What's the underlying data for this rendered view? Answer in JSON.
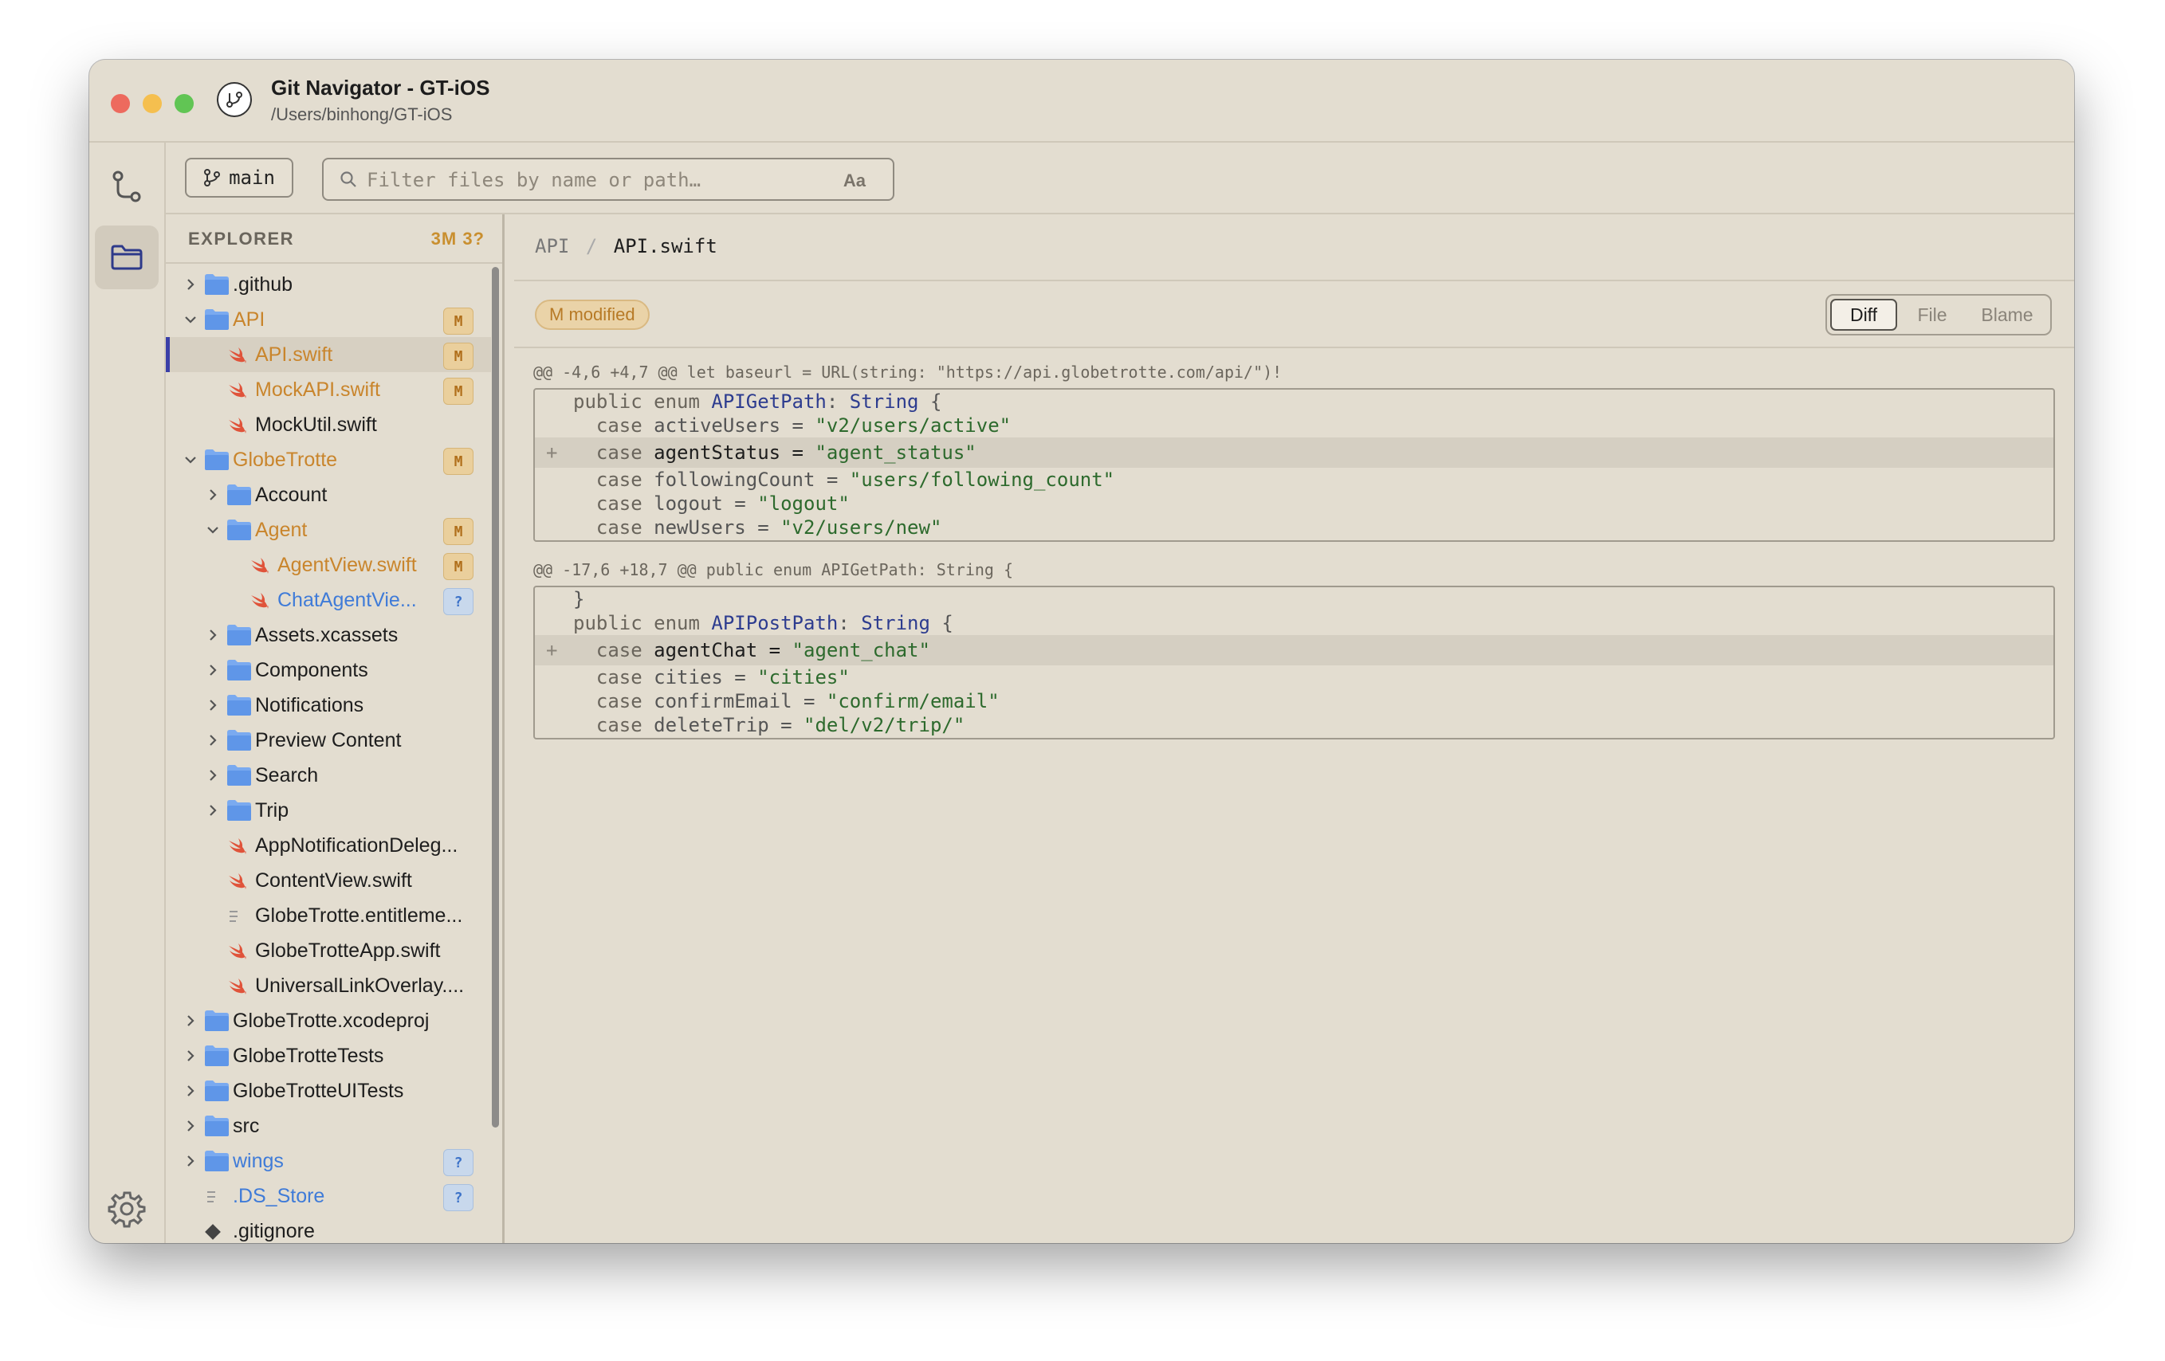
{
  "window": {
    "title": "Git Navigator - GT-iOS",
    "subtitle": "/Users/binhong/GT-iOS"
  },
  "toolbar": {
    "branch": "main",
    "search_placeholder": "Filter files by name or path…",
    "case_toggle": "Aa"
  },
  "explorer": {
    "title": "EXPLORER",
    "counts": "3M 3?",
    "rows": [
      {
        "name": ".github",
        "kind": "folder",
        "depth": 0,
        "expanded": false,
        "status": ""
      },
      {
        "name": "API",
        "kind": "folder",
        "depth": 0,
        "expanded": true,
        "status": "M"
      },
      {
        "name": "API.swift",
        "kind": "swift",
        "depth": 1,
        "status": "M",
        "selected": true
      },
      {
        "name": "MockAPI.swift",
        "kind": "swift",
        "depth": 1,
        "status": "M"
      },
      {
        "name": "MockUtil.swift",
        "kind": "swift",
        "depth": 1,
        "status": ""
      },
      {
        "name": "GlobeTrotte",
        "kind": "folder",
        "depth": 0,
        "expanded": true,
        "status": "M"
      },
      {
        "name": "Account",
        "kind": "folder",
        "depth": 1,
        "expanded": false,
        "status": ""
      },
      {
        "name": "Agent",
        "kind": "folder",
        "depth": 1,
        "expanded": true,
        "status": "M"
      },
      {
        "name": "AgentView.swift",
        "kind": "swift",
        "depth": 2,
        "status": "M"
      },
      {
        "name": "ChatAgentVie...",
        "kind": "swift",
        "depth": 2,
        "status": "?"
      },
      {
        "name": "Assets.xcassets",
        "kind": "folder",
        "depth": 1,
        "expanded": false,
        "status": ""
      },
      {
        "name": "Components",
        "kind": "folder",
        "depth": 1,
        "expanded": false,
        "status": ""
      },
      {
        "name": "Notifications",
        "kind": "folder",
        "depth": 1,
        "expanded": false,
        "status": ""
      },
      {
        "name": "Preview Content",
        "kind": "folder",
        "depth": 1,
        "expanded": false,
        "status": ""
      },
      {
        "name": "Search",
        "kind": "folder",
        "depth": 1,
        "expanded": false,
        "status": ""
      },
      {
        "name": "Trip",
        "kind": "folder",
        "depth": 1,
        "expanded": false,
        "status": ""
      },
      {
        "name": "AppNotificationDeleg...",
        "kind": "swift",
        "depth": 1,
        "status": ""
      },
      {
        "name": "ContentView.swift",
        "kind": "swift",
        "depth": 1,
        "status": ""
      },
      {
        "name": "GlobeTrotte.entitleme...",
        "kind": "text",
        "depth": 1,
        "status": ""
      },
      {
        "name": "GlobeTrotteApp.swift",
        "kind": "swift",
        "depth": 1,
        "status": ""
      },
      {
        "name": "UniversalLinkOverlay....",
        "kind": "swift",
        "depth": 1,
        "status": ""
      },
      {
        "name": "GlobeTrotte.xcodeproj",
        "kind": "folder",
        "depth": 0,
        "expanded": false,
        "status": ""
      },
      {
        "name": "GlobeTrotteTests",
        "kind": "folder",
        "depth": 0,
        "expanded": false,
        "status": ""
      },
      {
        "name": "GlobeTrotteUITests",
        "kind": "folder",
        "depth": 0,
        "expanded": false,
        "status": ""
      },
      {
        "name": "src",
        "kind": "folder",
        "depth": 0,
        "expanded": false,
        "status": ""
      },
      {
        "name": "wings",
        "kind": "folder",
        "depth": 0,
        "expanded": false,
        "status": "?"
      },
      {
        "name": ".DS_Store",
        "kind": "text",
        "depth": 0,
        "status": "?"
      },
      {
        "name": ".gitignore",
        "kind": "git",
        "depth": 0,
        "status": ""
      }
    ]
  },
  "editor": {
    "breadcrumb_parent": "API",
    "breadcrumb_sep": "/",
    "breadcrumb_file": "API.swift",
    "file_status": "M modified",
    "view_modes": [
      "Diff",
      "File",
      "Blame"
    ],
    "active_mode": "Diff",
    "hunks": [
      {
        "header": "@@ -4,6 +4,7 @@ let baseurl = URL(string: \"https://api.globetrotte.com/api/\")!",
        "lines": [
          {
            "type": "ctx",
            "tokens": [
              [
                "kw",
                "public enum "
              ],
              [
                "ty",
                "APIGetPath"
              ],
              [
                "pl",
                ": "
              ],
              [
                "ty",
                "String"
              ],
              [
                "pl",
                " {"
              ]
            ]
          },
          {
            "type": "ctx",
            "tokens": [
              [
                "kw",
                "  case "
              ],
              [
                "pl",
                "activeUsers = "
              ],
              [
                "str",
                "\"v2/users/active\""
              ]
            ]
          },
          {
            "type": "add",
            "tokens": [
              [
                "kw",
                "  case "
              ],
              [
                "pl",
                "agentStatus = "
              ],
              [
                "str",
                "\"agent_status\""
              ]
            ]
          },
          {
            "type": "ctx",
            "tokens": [
              [
                "kw",
                "  case "
              ],
              [
                "pl",
                "followingCount = "
              ],
              [
                "str",
                "\"users/following_count\""
              ]
            ]
          },
          {
            "type": "ctx",
            "tokens": [
              [
                "kw",
                "  case "
              ],
              [
                "pl",
                "logout = "
              ],
              [
                "str",
                "\"logout\""
              ]
            ]
          },
          {
            "type": "ctx",
            "tokens": [
              [
                "kw",
                "  case "
              ],
              [
                "pl",
                "newUsers = "
              ],
              [
                "str",
                "\"v2/users/new\""
              ]
            ]
          }
        ]
      },
      {
        "header": "@@ -17,6 +18,7 @@ public enum APIGetPath: String {",
        "lines": [
          {
            "type": "ctx",
            "tokens": [
              [
                "pl",
                "}"
              ]
            ]
          },
          {
            "type": "ctx",
            "tokens": [
              [
                "kw",
                "public enum "
              ],
              [
                "ty",
                "APIPostPath"
              ],
              [
                "pl",
                ": "
              ],
              [
                "ty",
                "String"
              ],
              [
                "pl",
                " {"
              ]
            ]
          },
          {
            "type": "add",
            "tokens": [
              [
                "kw",
                "  case "
              ],
              [
                "pl",
                "agentChat = "
              ],
              [
                "str",
                "\"agent_chat\""
              ]
            ]
          },
          {
            "type": "ctx",
            "tokens": [
              [
                "kw",
                "  case "
              ],
              [
                "pl",
                "cities = "
              ],
              [
                "str",
                "\"cities\""
              ]
            ]
          },
          {
            "type": "ctx",
            "tokens": [
              [
                "kw",
                "  case "
              ],
              [
                "pl",
                "confirmEmail = "
              ],
              [
                "str",
                "\"confirm/email\""
              ]
            ]
          },
          {
            "type": "ctx",
            "tokens": [
              [
                "kw",
                "  case "
              ],
              [
                "pl",
                "deleteTrip = "
              ],
              [
                "str",
                "\"del/v2/trip/\""
              ]
            ]
          }
        ]
      }
    ]
  },
  "colors": {
    "modified": "#c9852c",
    "untracked": "#3f7bd8",
    "swift_icon": "#e0533a",
    "folder_icon": "#7aaaf0",
    "accent": "#3a3fa8"
  }
}
